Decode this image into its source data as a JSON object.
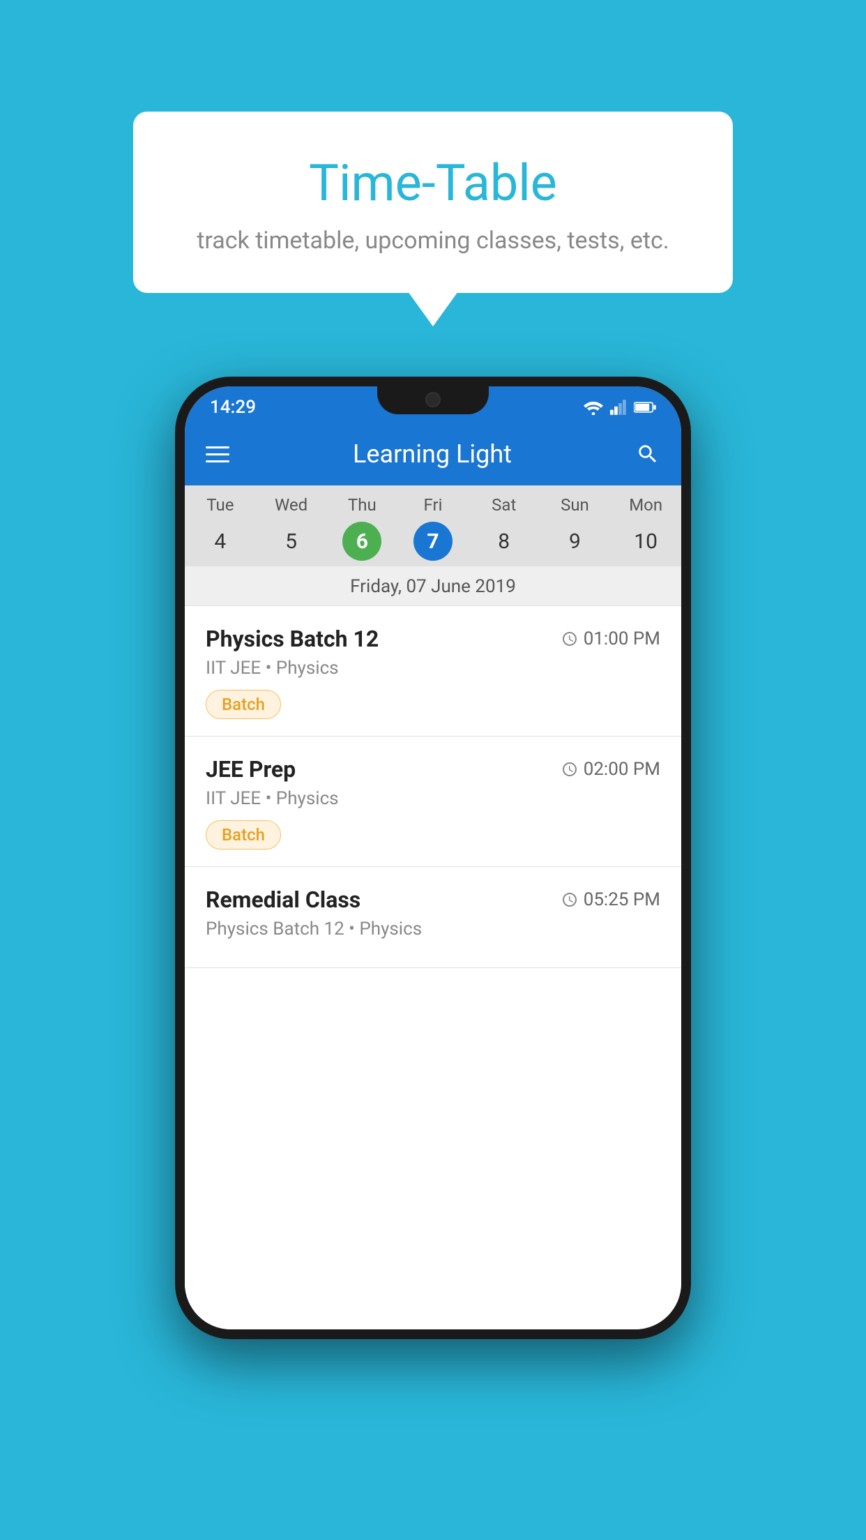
{
  "page": {
    "background_color": "#29B6D8"
  },
  "speech_bubble": {
    "title": "Time-Table",
    "subtitle": "track timetable, upcoming classes, tests, etc."
  },
  "phone": {
    "status_bar": {
      "time": "14:29"
    },
    "app_bar": {
      "title": "Learning Light",
      "menu_icon_label": "menu",
      "search_icon_label": "search"
    },
    "calendar": {
      "days": [
        {
          "name": "Tue",
          "num": "4",
          "state": "normal"
        },
        {
          "name": "Wed",
          "num": "5",
          "state": "normal"
        },
        {
          "name": "Thu",
          "num": "6",
          "state": "today"
        },
        {
          "name": "Fri",
          "num": "7",
          "state": "selected"
        },
        {
          "name": "Sat",
          "num": "8",
          "state": "normal"
        },
        {
          "name": "Sun",
          "num": "9",
          "state": "normal"
        },
        {
          "name": "Mon",
          "num": "10",
          "state": "normal"
        }
      ],
      "selected_date_label": "Friday, 07 June 2019"
    },
    "schedule_items": [
      {
        "title": "Physics Batch 12",
        "time": "01:00 PM",
        "subtitle": "IIT JEE • Physics",
        "badge": "Batch"
      },
      {
        "title": "JEE Prep",
        "time": "02:00 PM",
        "subtitle": "IIT JEE • Physics",
        "badge": "Batch"
      },
      {
        "title": "Remedial Class",
        "time": "05:25 PM",
        "subtitle": "Physics Batch 12 • Physics",
        "badge": null
      }
    ]
  }
}
